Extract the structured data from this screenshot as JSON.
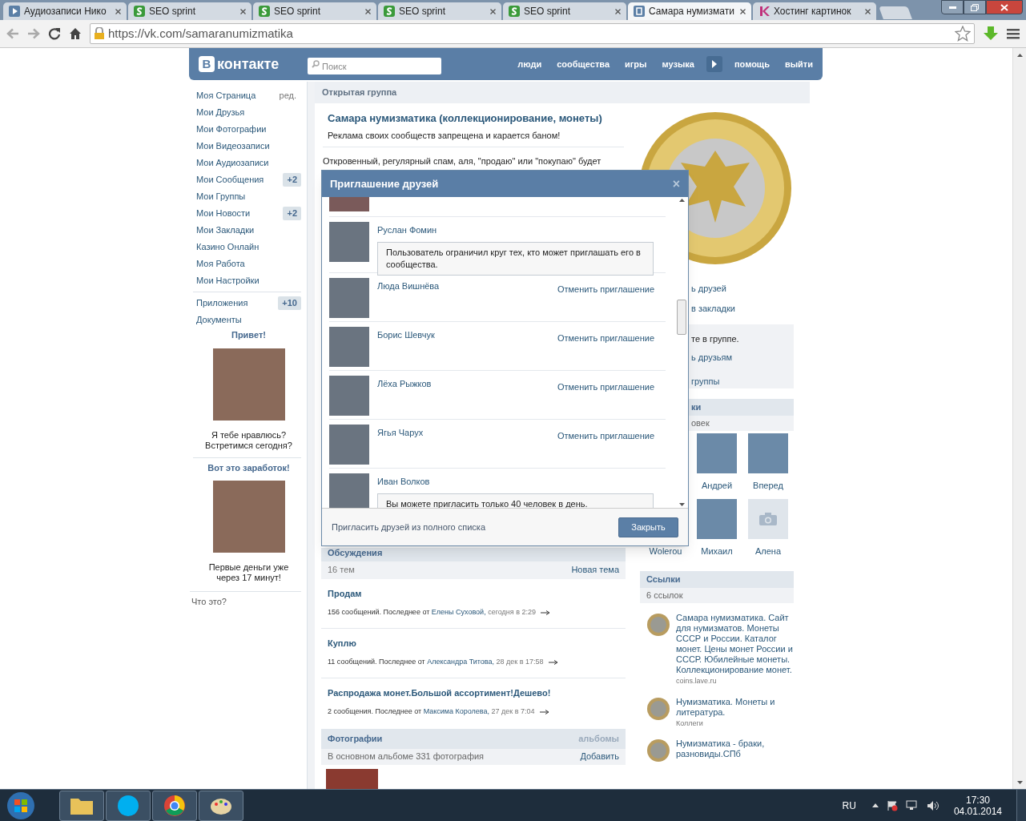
{
  "browser": {
    "tabs": [
      {
        "kind": "audio",
        "title": "Аудиозаписи Нико",
        "selected": false
      },
      {
        "kind": "seo",
        "title": "SEO sprint",
        "selected": false
      },
      {
        "kind": "seo",
        "title": "SEO sprint",
        "selected": false
      },
      {
        "kind": "seo",
        "title": "SEO sprint",
        "selected": false
      },
      {
        "kind": "seo",
        "title": "SEO sprint",
        "selected": false
      },
      {
        "kind": "vk",
        "title": "Самара нумизмати",
        "selected": true
      },
      {
        "kind": "k",
        "title": "Хостинг картинок",
        "selected": false
      }
    ],
    "url": "https://vk.com/samaranumizmatika"
  },
  "header": {
    "logo_letter": "В",
    "logo_text": "контакте",
    "search_placeholder": "Поиск",
    "nav": [
      {
        "kind": "link",
        "label": "люди"
      },
      {
        "kind": "link",
        "label": "сообщества"
      },
      {
        "kind": "link",
        "label": "игры"
      },
      {
        "kind": "link",
        "label": "музыка"
      },
      {
        "kind": "play"
      },
      {
        "kind": "link",
        "label": "помощь"
      },
      {
        "kind": "link",
        "label": "выйти"
      }
    ]
  },
  "sidebar": {
    "menu": [
      {
        "label": "Моя Страница",
        "edit": "ред."
      },
      {
        "label": "Мои Друзья"
      },
      {
        "label": "Мои Фотографии"
      },
      {
        "label": "Мои Видеозаписи"
      },
      {
        "label": "Мои Аудиозаписи"
      },
      {
        "label": "Мои Сообщения",
        "badge": "+2"
      },
      {
        "label": "Мои Группы"
      },
      {
        "label": "Мои Новости",
        "badge": "+2"
      },
      {
        "label": "Мои Закладки"
      },
      {
        "label": "Казино Онлайн"
      },
      {
        "label": "Моя Работа"
      },
      {
        "label": "Мои Настройки"
      }
    ],
    "extra": [
      {
        "label": "Приложения",
        "badge": "+10"
      },
      {
        "label": "Документы"
      }
    ],
    "ads": [
      {
        "title": "Привет!",
        "text": "Я тебе нравлюсь? Встретимся сегодня?"
      },
      {
        "title": "Вот это заработок!",
        "text": "Первые деньги уже через 17 минут!"
      }
    ],
    "ads_link": "Что это?"
  },
  "group": {
    "type_label": "Открытая группа",
    "title": "Самара нумизматика (коллекционирование, монеты)",
    "status": "Реклама своих сообществ запрещена и карается баном!",
    "description": "Откровенный, регулярный спам, аля, \"продаю\" или \"покупаю\" будет"
  },
  "discussions": {
    "title": "Обсуждения",
    "count": "16 тем",
    "new_topic": "Новая тема",
    "topics": [
      {
        "title": "Продам",
        "meta": "156 сообщений. Последнее от",
        "author": "Елены Суховой,",
        "time": "сегодня в 2:29"
      },
      {
        "title": "Куплю",
        "meta": "11 сообщений. Последнее от",
        "author": "Александра Титова,",
        "time": "28 дек в 17:58"
      },
      {
        "title": "Распродажа монет.Большой ассортимент!Дешево!",
        "meta": "2 сообщения. Последнее от",
        "author": "Максима Королева,",
        "time": "27 дек в 7:04"
      }
    ]
  },
  "photos": {
    "title": "Фотографии",
    "albums": "альбомы",
    "count": "В основном альбоме 331 фотография",
    "add": "Добавить"
  },
  "right": {
    "actions": [
      "ь друзей",
      "в закладки"
    ],
    "membership": [
      "те в группе.",
      "ь друзьям",
      "группы"
    ],
    "members_title": "ки",
    "members_count": "овек",
    "members": [
      {
        "name": "Андрей",
        "kind": "photo"
      },
      {
        "name": "Вперед",
        "kind": "photo"
      },
      {
        "name": "Wolerou",
        "kind": "hidden"
      },
      {
        "name": "Михаил",
        "kind": "photo"
      },
      {
        "name": "Алена",
        "kind": "camera"
      }
    ],
    "links_title": "Ссылки",
    "links_count": "6 ссылок",
    "links": [
      {
        "title": "Самара нумизматика. Сайт для нумизматов. Монеты СССР и России. Каталог монет. Цены монет России и СССР. Юбилейные монеты. Коллекционирование монет.",
        "subtitle": "coins.lave.ru"
      },
      {
        "title": "Нумизматика. Монеты и литература.",
        "subtitle": "Коллеги"
      },
      {
        "title": "Нумизматика - браки, разновиды.СПб"
      }
    ]
  },
  "modal": {
    "title": "Приглашение друзей",
    "close": "×",
    "rows": [
      {
        "kind": "partial"
      },
      {
        "kind": "notice",
        "name": "Руслан Фомин",
        "text": "Пользователь ограничил круг тех, кто может приглашать его в сообщества."
      },
      {
        "kind": "action",
        "name": "Люда Вишнёва",
        "text": "Отменить приглашение"
      },
      {
        "kind": "action",
        "name": "Борис Шевчук",
        "text": "Отменить приглашение"
      },
      {
        "kind": "action",
        "name": "Лёха Рыжков",
        "text": "Отменить приглашение"
      },
      {
        "kind": "action",
        "name": "Ягья Чарух",
        "text": "Отменить приглашение"
      },
      {
        "kind": "notice",
        "name": "Иван Волков",
        "text": "Вы можете пригласить только 40 человек в день."
      }
    ],
    "footer_link": "Пригласить друзей из полного списка",
    "close_button": "Закрыть"
  },
  "taskbar": {
    "language": "RU",
    "time": "17:30",
    "date": "04.01.2014"
  }
}
